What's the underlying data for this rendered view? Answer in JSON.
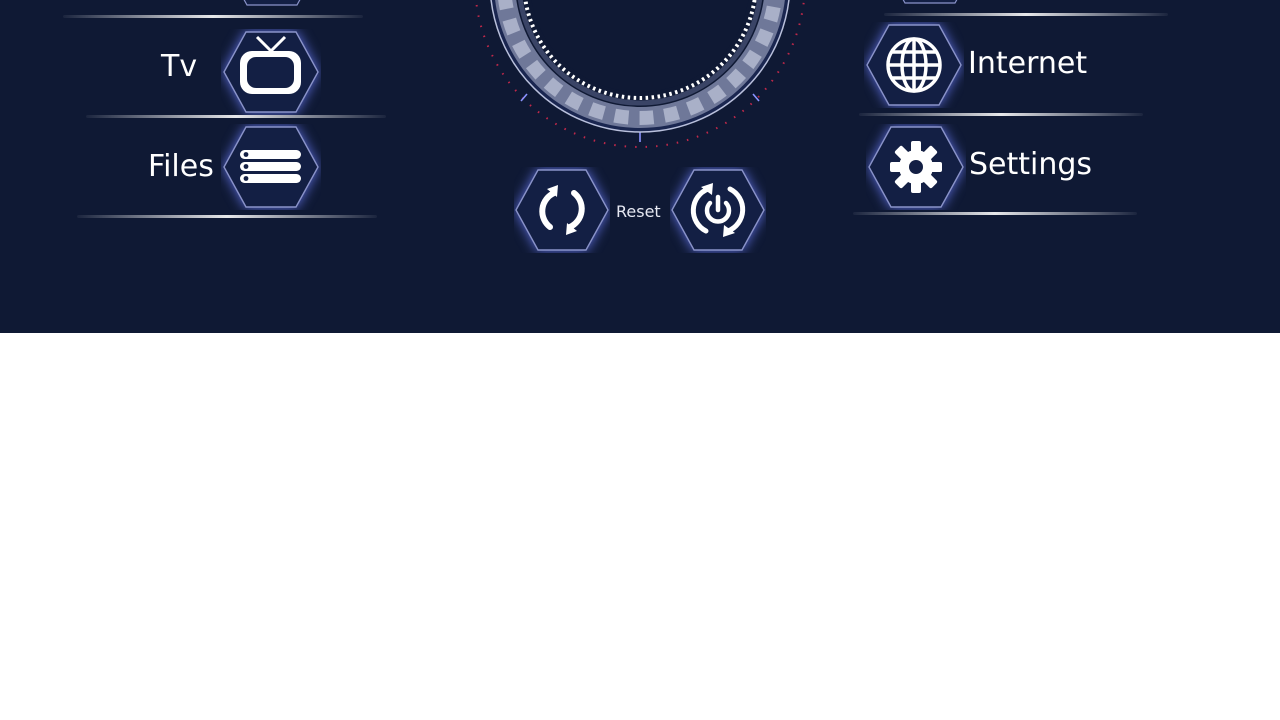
{
  "menu": {
    "left": [
      {
        "label": "Tv",
        "icon": "tv-icon"
      },
      {
        "label": "Files",
        "icon": "files-list-icon"
      }
    ],
    "right": [
      {
        "label": "Internet",
        "icon": "globe-icon"
      },
      {
        "label": "Settings",
        "icon": "gear-icon"
      }
    ]
  },
  "controls": {
    "reset_label": "Reset",
    "reset_icon": "refresh-icon",
    "power_icon": "power-cycle-icon"
  },
  "colors": {
    "background": "#0f1934",
    "page_below": "#ffffff",
    "text": "#ffffff",
    "hex_border": "#8a93c9",
    "dial_ring": "#7c85a6",
    "dial_dots": "#c0284a"
  }
}
